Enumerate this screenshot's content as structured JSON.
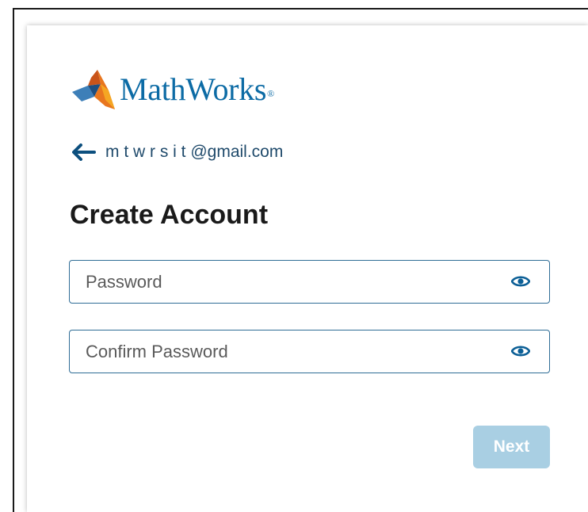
{
  "brand": {
    "name": "MathWorks",
    "registered_mark": "®",
    "text_color": "#0c6ba5"
  },
  "account": {
    "back_icon": "arrow-left-icon",
    "email": "m t w r s i t @gmail.com"
  },
  "form": {
    "title": "Create Account",
    "password": {
      "placeholder": "Password",
      "value": "",
      "toggle_icon": "eye-icon"
    },
    "confirm_password": {
      "placeholder": "Confirm Password",
      "value": "",
      "toggle_icon": "eye-icon"
    },
    "next_label": "Next",
    "next_enabled": false
  },
  "colors": {
    "accent": "#0c6ba5",
    "field_border": "#2f6d96",
    "button_disabled": "#a9cfe3",
    "title": "#1a1a1a"
  }
}
